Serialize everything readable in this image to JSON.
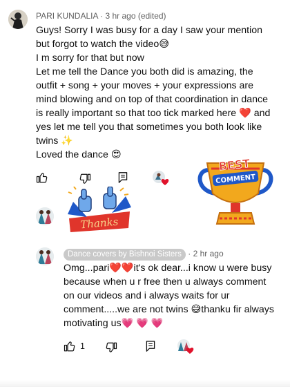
{
  "comment": {
    "author": "PARI KUNDALIA",
    "time": "3 hr ago (edited)",
    "paragraphs": [
      "Guys! Sorry I was busy for a day I saw your mention but forgot to watch the video😅",
      "I m sorry for that but now",
      "Let me tell the Dance you both did is amazing, the outfit + song + your moves + your expressions are mind blowing and on top of that coordination in dance is really important so that too tick marked here ❤️ and yes let me tell you that sometimes you both look like twins ✨",
      "Loved the dance 😍"
    ],
    "actions": {
      "like_icon": "thumb-up-icon",
      "dislike_icon": "thumb-down-icon",
      "reply_icon": "reply-icon",
      "heart_icon": "creator-heart-icon"
    }
  },
  "sticker_left": {
    "text": "Thanks"
  },
  "sticker_right": {
    "line1": "BEST",
    "line2": "COMMENT"
  },
  "reply": {
    "author": "Dance covers by Bishnoi Sisters",
    "time": "2 hr ago",
    "text": "Omg...pari❤️❤️it's ok dear...i know u were busy because when u r free then u always comment on our videos and i always waits for ur comment.....we are not twins 😅thanku fir always motivating us💗 💗 💗",
    "like_count": "1"
  },
  "colors": {
    "meta": "#606060",
    "chip_bg": "#c9c9c9",
    "heart": "#e0122b",
    "trophy_gold": "#f2a81d",
    "ribbon_blue": "#1f58c8",
    "ribbon_red": "#e0352b"
  }
}
